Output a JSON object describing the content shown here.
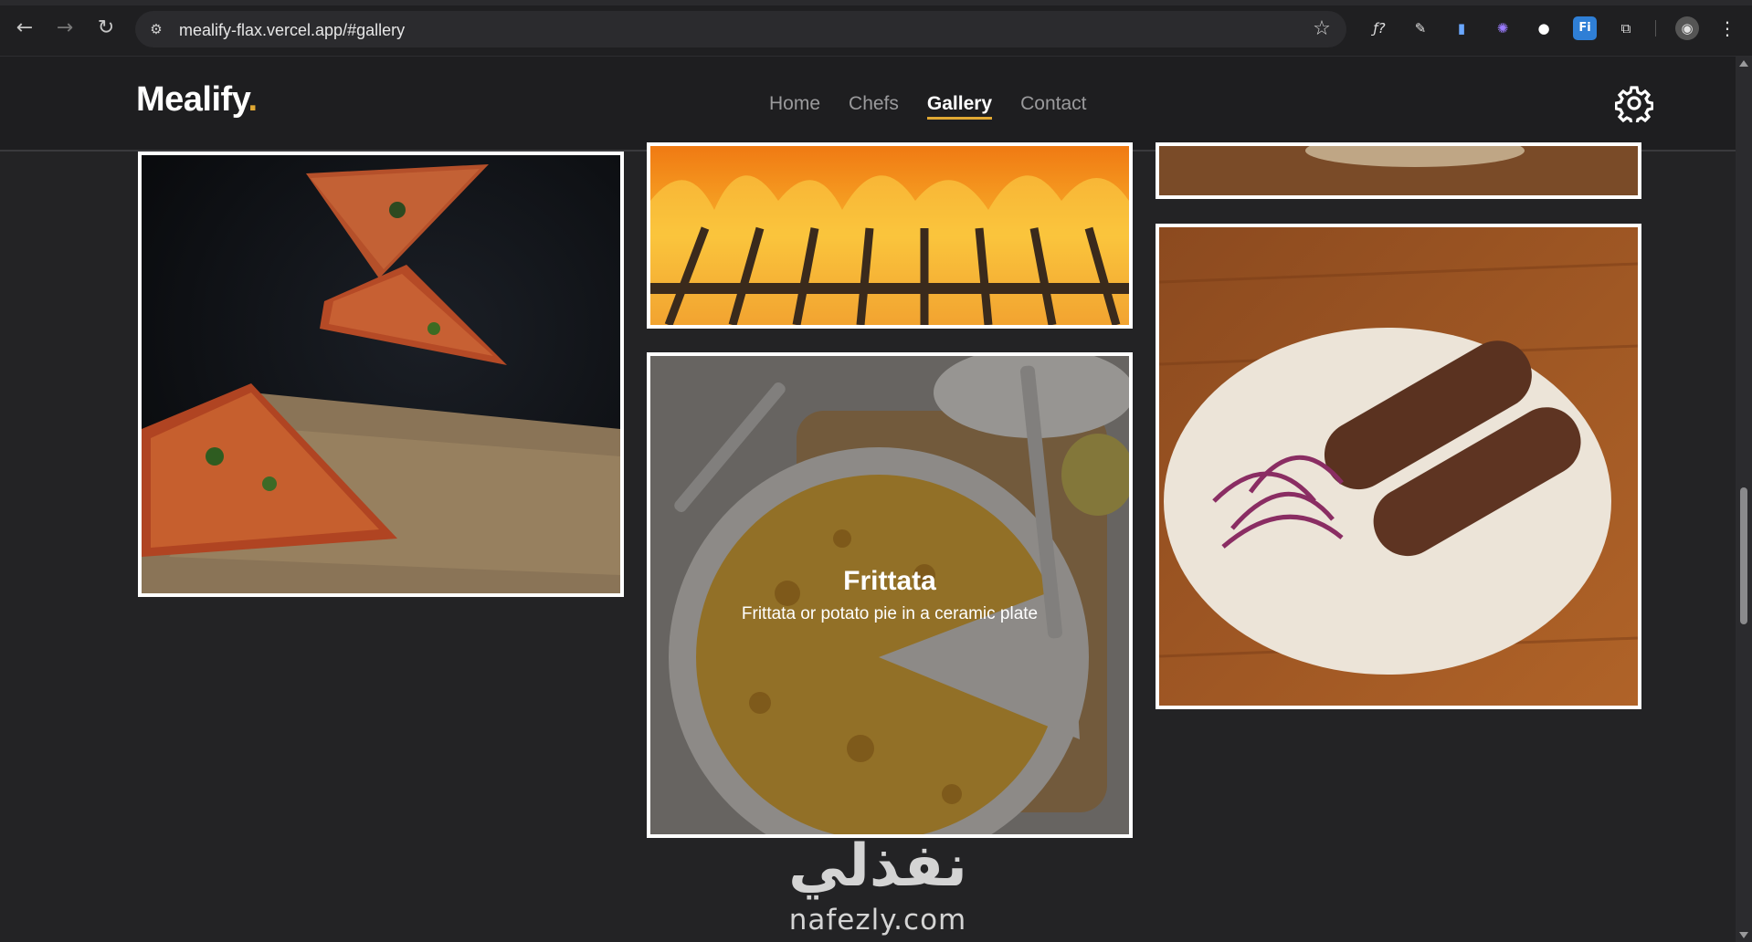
{
  "browser": {
    "url": "mealify-flax.vercel.app/#gallery",
    "back_icon": "←",
    "forward_icon": "→",
    "reload_icon": "↻",
    "site_icon": "⚙",
    "star_icon": "☆",
    "extensions": [
      {
        "name": "fx-icon",
        "glyph": "ƒ?"
      },
      {
        "name": "eyedropper-icon",
        "glyph": "✎"
      },
      {
        "name": "document-icon",
        "glyph": "▮"
      },
      {
        "name": "puzzle-gear-icon",
        "glyph": "✺"
      },
      {
        "name": "circle-icon",
        "glyph": "●"
      },
      {
        "name": "fi-icon",
        "glyph": "Fi"
      },
      {
        "name": "extensions-icon",
        "glyph": "⧉"
      },
      {
        "name": "profile-avatar",
        "glyph": "◉"
      },
      {
        "name": "menu-icon",
        "glyph": "⋮"
      }
    ]
  },
  "header": {
    "logo_text": "Mealify",
    "logo_dot": ".",
    "nav": [
      {
        "label": "Home"
      },
      {
        "label": "Chefs"
      },
      {
        "label": "Gallery",
        "active": true
      },
      {
        "label": "Contact"
      }
    ]
  },
  "gallery": {
    "featured": {
      "title": "Frittata",
      "description": "Frittata or potato pie in a ceramic plate"
    }
  },
  "watermark": {
    "arabic": "نفذلي",
    "latin": "nafezly.com"
  },
  "colors": {
    "accent": "#e0a833",
    "background": "#232325",
    "header": "#1e1e20"
  }
}
